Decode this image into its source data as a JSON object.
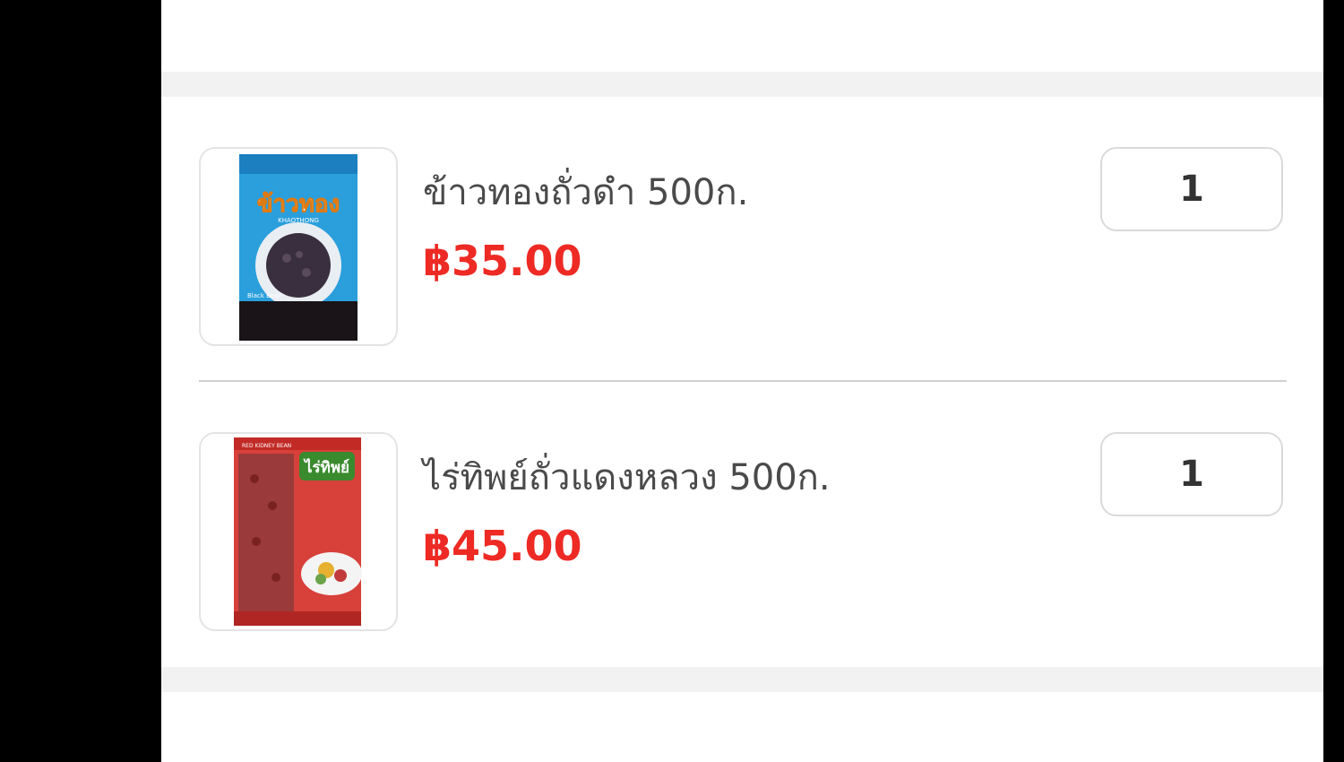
{
  "cart": {
    "items": [
      {
        "name": "ข้าวทองถั่วดำ 500ก.",
        "price": "฿35.00",
        "quantity": "1",
        "image_label": "ข้าวทอง",
        "image_sub": "KHAOTHONG",
        "image_tag": "Black Bean"
      },
      {
        "name": "ไร่ทิพย์ถั่วแดงหลวง 500ก.",
        "price": "฿45.00",
        "quantity": "1",
        "image_label": "ไร่ทิพย์",
        "image_tag": "RED KIDNEY BEAN"
      }
    ]
  },
  "colors": {
    "price": "#ee2a24",
    "section_gap": "#f2f2f2"
  }
}
